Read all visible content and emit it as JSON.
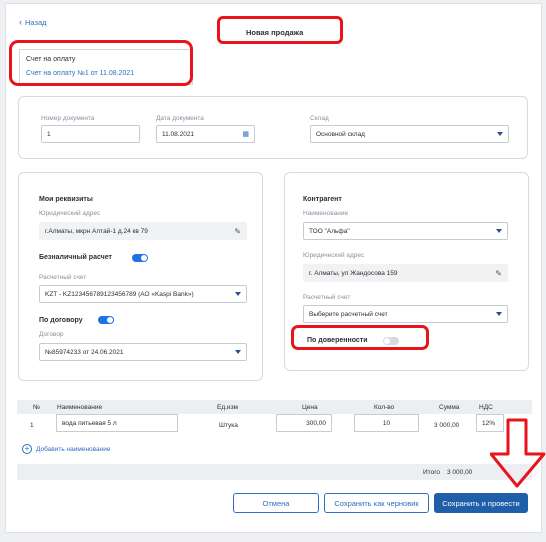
{
  "nav": {
    "back_label": "Назад"
  },
  "page": {
    "title": "Новая продажа"
  },
  "invoice": {
    "label": "Счет на оплату",
    "link": "Счет на оплату №1 от 11.08.2021"
  },
  "doc": {
    "number_label": "Номер документа",
    "number_value": "1",
    "date_label": "Дата документа",
    "date_value": "11.08.2021",
    "warehouse_label": "Склад",
    "warehouse_value": "Основной склад"
  },
  "my_details": {
    "title": "Мои реквизиты",
    "address_label": "Юридический адрес",
    "address_value": "г.Алматы, мкрн Алтай-1 д.24 кв 79",
    "cashless_label": "Безналичный расчет",
    "cashless_on": true,
    "account_label": "Расчетный счет",
    "account_value": "KZT - KZ123456789123456789 (АО «Kaspi Bank»)",
    "contract_toggle_label": "По договору",
    "contract_on": true,
    "contract_label": "Договор",
    "contract_value": "№85974233 от 24.06.2021"
  },
  "counterparty": {
    "title": "Контрагент",
    "name_label": "Наименование",
    "name_value": "ТОО \"Альфа\"",
    "address_label": "Юридический адрес",
    "address_value": "г. Алматы, ул Жандосова 159",
    "account_label": "Расчетный счет",
    "account_placeholder": "Выберите расчетный счет",
    "proxy_label": "По доверенности",
    "proxy_on": false
  },
  "table": {
    "headers": {
      "num": "№",
      "name": "Наименование",
      "unit": "Ед.изм",
      "price": "Цена",
      "qty": "Кол-во",
      "sum": "Сумма",
      "vat": "НДС"
    },
    "rows": [
      {
        "num": "1",
        "name": "вода питьевая 5 л",
        "unit": "Штука",
        "price": "300,00",
        "qty": "10",
        "sum": "3 000,00",
        "vat": "12%"
      }
    ],
    "add_label": "Добавить наименование",
    "total_label": "Итого",
    "total_value": "3 000,00"
  },
  "actions": {
    "cancel": "Отмена",
    "save_draft": "Сохранить как черновик",
    "save_post": "Сохранить и провести"
  },
  "colors": {
    "accent": "#1e73e8",
    "primary_button": "#1f5ea8",
    "annotation_red": "#e8131b"
  },
  "icons": {
    "back": "chevron-left-icon",
    "calendar": "calendar-icon",
    "edit": "pencil-icon",
    "add": "plus-circle-icon",
    "annotation": "arrow-down-icon"
  }
}
